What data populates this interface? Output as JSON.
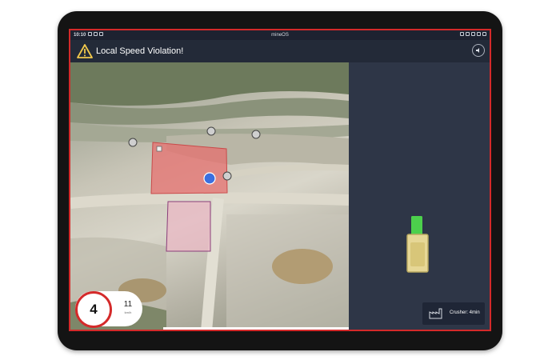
{
  "statusbar": {
    "time": "10:10",
    "app_name": "mineOS"
  },
  "alert": {
    "title": "Local Speed Violation!",
    "warning_icon": "warning-icon",
    "sound_icon": "speaker-icon",
    "alert_color": "#f2c94c"
  },
  "speed": {
    "limit": "4",
    "current": "11",
    "unit": "km/h",
    "limit_color": "#d42a2a"
  },
  "crusher": {
    "label": "Crusher: 4min",
    "icon": "factory-icon"
  },
  "map": {
    "violation_zone_color": "#e86b6b",
    "secondary_zone_color": "#e9b8c4",
    "vehicle_color": "#3b6fe0"
  },
  "truck": {
    "cab_color": "#4cd04c",
    "bed_color": "#e6d796"
  }
}
